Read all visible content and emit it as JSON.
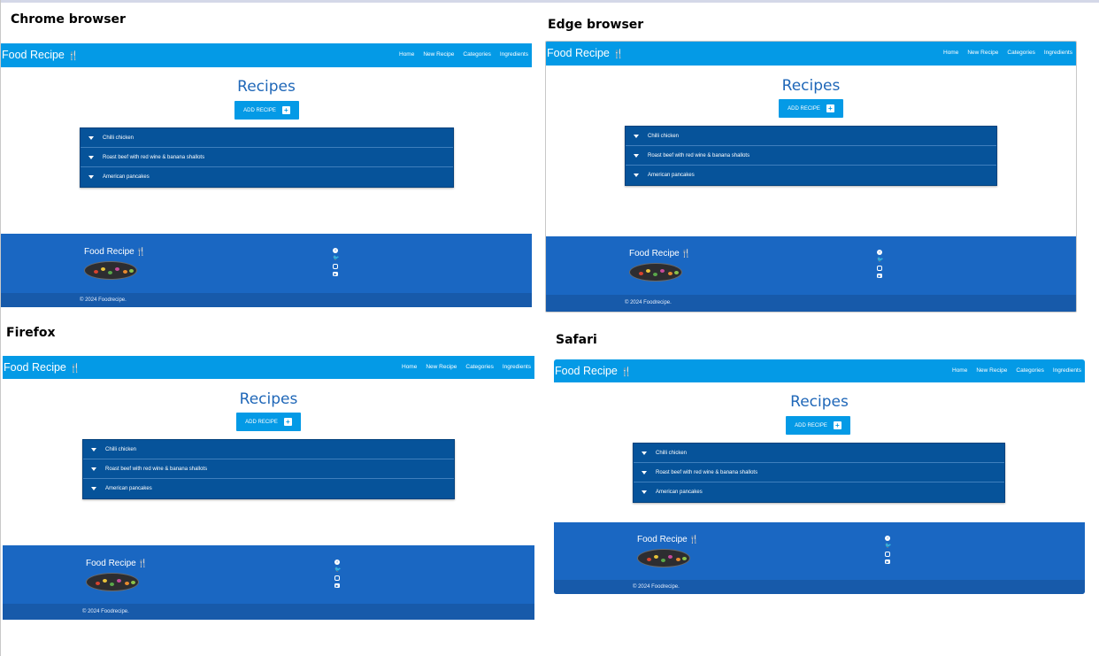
{
  "captions": {
    "chrome": "Chrome browser",
    "edge": "Edge browser",
    "firefox": "Firefox",
    "safari": "Safari"
  },
  "site": {
    "brand": "Food Recipe",
    "brand_icon": "fork-knife-icon",
    "nav": [
      "Home",
      "New Recipe",
      "Categories",
      "Ingredients"
    ],
    "page_title": "Recipes",
    "add_button": "ADD RECIPE",
    "add_button_icon": "plus-square-icon",
    "recipes": [
      "Chilli chicken",
      "Roast beef with red wine & banana shallots",
      "American pancakes"
    ],
    "footer_brand": "Food Recipe",
    "social_icons": [
      "facebook-icon",
      "twitter-icon",
      "instagram-icon",
      "youtube-icon"
    ],
    "copyright": "© 2024 Foodrecipe."
  },
  "colors": {
    "navbar": "#049ae6",
    "title": "#1f67b8",
    "list": "#06539a",
    "footer": "#1a67c2",
    "copybar": "#175aaa"
  }
}
